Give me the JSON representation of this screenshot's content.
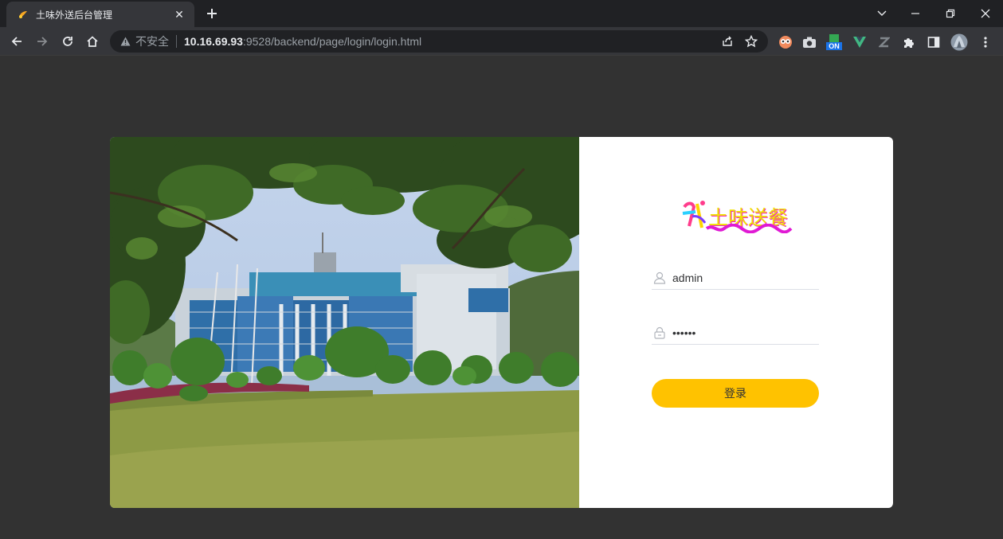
{
  "browser": {
    "tab_title": "土味外送后台管理",
    "tab_close": "✕",
    "new_tab": "+",
    "insecure_label": "不安全",
    "url_host": "10.16.69.93",
    "url_rest": ":9528/backend/page/login/login.html",
    "extension_badge": "ON"
  },
  "login": {
    "logo_text": "土味送餐",
    "logo_mark": "外",
    "username_value": "admin",
    "password_value": "123456",
    "submit_label": "登录"
  },
  "colors": {
    "page_background": "#323232",
    "button": "#ffc200",
    "logo_yellow": "#f0e000",
    "logo_magenta": "#f020c0"
  }
}
